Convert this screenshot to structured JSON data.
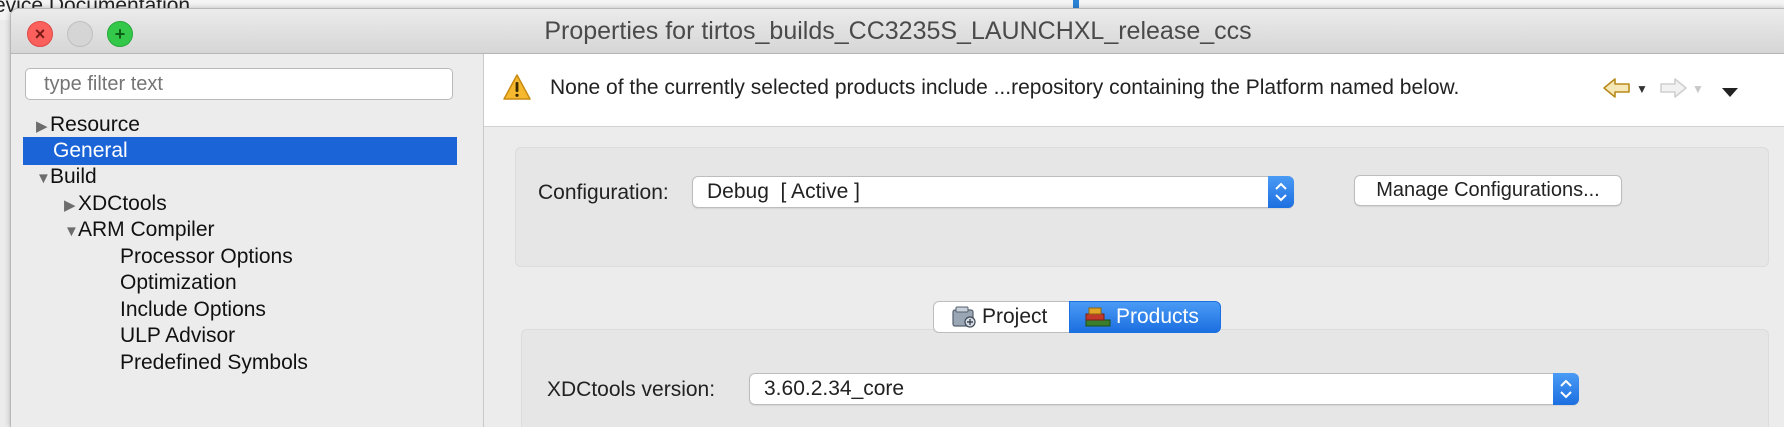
{
  "background": {
    "text": "evice Documentation"
  },
  "window": {
    "title": "Properties for tirtos_builds_CC3235S_LAUNCHXL_release_ccs",
    "traffic": {
      "close": "×",
      "minimize": "",
      "maximize": "+"
    }
  },
  "filter": {
    "placeholder": "type filter text"
  },
  "tree": {
    "items": [
      {
        "label": "Resource",
        "state": "collapsed"
      },
      {
        "label": "General",
        "state": "selected"
      },
      {
        "label": "Build",
        "state": "expanded"
      },
      {
        "label": "XDCtools",
        "state": "collapsed"
      },
      {
        "label": "ARM Compiler",
        "state": "expanded"
      },
      {
        "label": "Processor Options",
        "state": "leaf"
      },
      {
        "label": "Optimization",
        "state": "leaf"
      },
      {
        "label": "Include Options",
        "state": "leaf"
      },
      {
        "label": "ULP Advisor",
        "state": "leaf"
      },
      {
        "label": "Predefined Symbols",
        "state": "leaf"
      }
    ]
  },
  "message": {
    "icon": "warning-icon",
    "text": "None of the currently selected products include ...repository containing the Platform named below."
  },
  "nav": {
    "back_icon": "back-arrow-icon",
    "forward_icon": "forward-arrow-icon",
    "menu_icon": "view-menu-icon"
  },
  "configuration": {
    "label": "Configuration:",
    "value": "Debug  [ Active ]",
    "manage_button": "Manage Configurations..."
  },
  "tabs": {
    "project": "Project",
    "products": "Products",
    "active": "products"
  },
  "products": {
    "xdctools_label": "XDCtools version:",
    "xdctools_value": "3.60.2.34_core"
  },
  "colors": {
    "selection": "#1b64d7",
    "accent": "#1c6fe0",
    "warning": "#f5b82e"
  }
}
